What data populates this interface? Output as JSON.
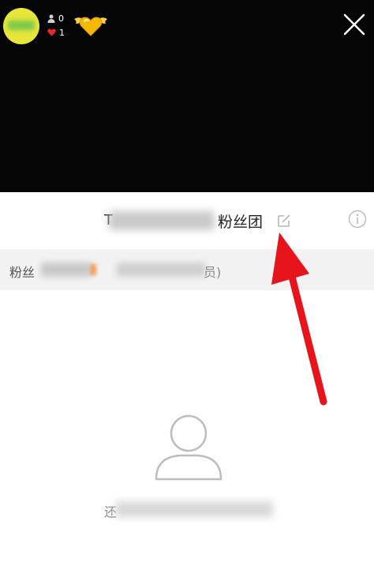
{
  "header": {
    "viewers_count": "0",
    "likes_count": "1",
    "icons": {
      "viewer": "person-icon",
      "likes": "heart-icon",
      "badge": "winged-heart-icon",
      "close": "close-icon"
    }
  },
  "title_bar": {
    "prefix": "T",
    "title": "粉丝团",
    "icons": {
      "edit": "edit-icon",
      "info": "info-icon"
    }
  },
  "fans_row": {
    "label": "粉丝",
    "suffix": "员)"
  },
  "empty_state": {
    "prefix": "还",
    "icon": "person-outline-icon"
  },
  "annotation": {
    "arrow_color": "#e8141c"
  },
  "colors": {
    "video_bg": "#050505",
    "fans_row_bg": "#f2f2f2",
    "badge": "#f5b800"
  }
}
